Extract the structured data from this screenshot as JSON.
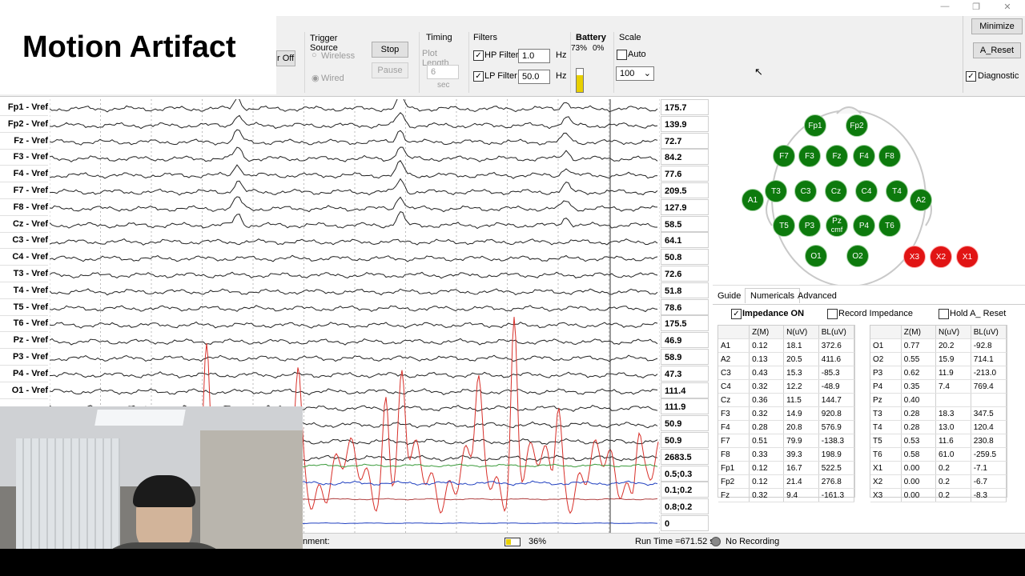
{
  "overlay_title": "Motion Artifact",
  "window": {
    "min": "—",
    "max": "❐",
    "close": "✕"
  },
  "toolbar": {
    "partial_button": "r Off",
    "trigger_source": {
      "title": "Trigger Source",
      "wireless": "Wireless",
      "wired": "Wired"
    },
    "stop_label": "Stop",
    "pause_label": "Pause",
    "timing": {
      "title": "Timing",
      "plot_length_label": "Plot Length",
      "plot_length_value": "6",
      "unit": "sec"
    },
    "filters": {
      "title": "Filters",
      "hp_label": "HP Filter",
      "hp_value": "1.0",
      "lp_label": "LP Filter",
      "lp_value": "50.0",
      "unit": "Hz"
    },
    "battery": {
      "title": "Battery",
      "pct1": "73%",
      "pct2": "0%",
      "level": 0.73,
      "color": "#e8d000"
    },
    "scale": {
      "title": "Scale",
      "auto_label": "Auto",
      "value": "100"
    },
    "minimize_label": "Minimize",
    "a_reset_label": "A_Reset",
    "diagnostic_label": "Diagnostic"
  },
  "channels": [
    {
      "label": "Fp1 - Vref",
      "value": "175.7"
    },
    {
      "label": "Fp2 - Vref",
      "value": "139.9"
    },
    {
      "label": "Fz - Vref",
      "value": "72.7"
    },
    {
      "label": "F3 - Vref",
      "value": "84.2"
    },
    {
      "label": "F4 - Vref",
      "value": "77.6"
    },
    {
      "label": "F7 - Vref",
      "value": "209.5"
    },
    {
      "label": "F8 - Vref",
      "value": "127.9"
    },
    {
      "label": "Cz - Vref",
      "value": "58.5"
    },
    {
      "label": "C3 - Vref",
      "value": "64.1"
    },
    {
      "label": "C4 - Vref",
      "value": "50.8"
    },
    {
      "label": "T3 - Vref",
      "value": "72.6"
    },
    {
      "label": "T4 - Vref",
      "value": "51.8"
    },
    {
      "label": "T5 - Vref",
      "value": "78.6"
    },
    {
      "label": "T6 - Vref",
      "value": "175.5"
    },
    {
      "label": "Pz - Vref",
      "value": "46.9"
    },
    {
      "label": "P3 - Vref",
      "value": "58.9"
    },
    {
      "label": "P4 - Vref",
      "value": "47.3"
    },
    {
      "label": "O1 - Vref",
      "value": "111.4"
    },
    {
      "label": "",
      "value": "111.9"
    },
    {
      "label": "",
      "value": "50.9"
    },
    {
      "label": "",
      "value": "50.9"
    },
    {
      "label": "",
      "value": "2683.5"
    },
    {
      "label": "",
      "value": "0.5;0.3"
    },
    {
      "label": "",
      "value": "0.1;0.2"
    },
    {
      "label": "",
      "value": "0.8;0.2"
    },
    {
      "label": "",
      "value": "0"
    }
  ],
  "electrodes": [
    {
      "name": "Fp1",
      "color": "green"
    },
    {
      "name": "Fp2",
      "color": "green"
    },
    {
      "name": "F7",
      "color": "green"
    },
    {
      "name": "F3",
      "color": "green"
    },
    {
      "name": "Fz",
      "color": "green"
    },
    {
      "name": "F4",
      "color": "green"
    },
    {
      "name": "F8",
      "color": "green"
    },
    {
      "name": "A1",
      "color": "green"
    },
    {
      "name": "T3",
      "color": "green"
    },
    {
      "name": "C3",
      "color": "green"
    },
    {
      "name": "Cz",
      "color": "green"
    },
    {
      "name": "C4",
      "color": "green"
    },
    {
      "name": "T4",
      "color": "green"
    },
    {
      "name": "A2",
      "color": "green"
    },
    {
      "name": "T5",
      "color": "green"
    },
    {
      "name": "P3",
      "color": "green"
    },
    {
      "name": "Pz",
      "sub": "cmf",
      "color": "green"
    },
    {
      "name": "P4",
      "color": "green"
    },
    {
      "name": "T6",
      "color": "green"
    },
    {
      "name": "O1",
      "color": "green"
    },
    {
      "name": "O2",
      "color": "green"
    },
    {
      "name": "X3",
      "color": "red"
    },
    {
      "name": "X2",
      "color": "red"
    },
    {
      "name": "X1",
      "color": "red"
    }
  ],
  "tabs": [
    "Guide",
    "Numericals",
    "Advanced"
  ],
  "options": {
    "impedance_on": "Impedance ON",
    "record_impedance": "Record Impedance",
    "hold_a_reset": "Hold A_ Reset"
  },
  "table_headers": [
    "",
    "Z(M)",
    "N(uV)",
    "BL(uV)"
  ],
  "table_left": [
    [
      "A1",
      "0.12",
      "18.1",
      "372.6"
    ],
    [
      "A2",
      "0.13",
      "20.5",
      "411.6"
    ],
    [
      "C3",
      "0.43",
      "15.3",
      "-85.3"
    ],
    [
      "C4",
      "0.32",
      "12.2",
      "-48.9"
    ],
    [
      "Cz",
      "0.36",
      "11.5",
      "144.7"
    ],
    [
      "F3",
      "0.32",
      "14.9",
      "920.8"
    ],
    [
      "F4",
      "0.28",
      "20.8",
      "576.9"
    ],
    [
      "F7",
      "0.51",
      "79.9",
      "-138.3"
    ],
    [
      "F8",
      "0.33",
      "39.3",
      "198.9"
    ],
    [
      "Fp1",
      "0.12",
      "16.7",
      "522.5"
    ],
    [
      "Fp2",
      "0.12",
      "21.4",
      "276.8"
    ],
    [
      "Fz",
      "0.32",
      "9.4",
      "-161.3"
    ]
  ],
  "table_right": [
    [
      "O1",
      "0.77",
      "20.2",
      "-92.8"
    ],
    [
      "O2",
      "0.55",
      "15.9",
      "714.1"
    ],
    [
      "P3",
      "0.62",
      "11.9",
      "-213.0"
    ],
    [
      "P4",
      "0.35",
      "7.4",
      "769.4"
    ],
    [
      "Pz",
      "0.40",
      "",
      ""
    ],
    [
      "T3",
      "0.28",
      "18.3",
      "347.5"
    ],
    [
      "T4",
      "0.28",
      "13.0",
      "120.4"
    ],
    [
      "T5",
      "0.53",
      "11.6",
      "230.8"
    ],
    [
      "T6",
      "0.58",
      "61.0",
      "-259.5"
    ],
    [
      "X1",
      "0.00",
      "0.2",
      "-7.1"
    ],
    [
      "X2",
      "0.00",
      "0.2",
      "-6.7"
    ],
    [
      "X3",
      "0.00",
      "0.2",
      "-8.3"
    ]
  ],
  "status": {
    "comment_label": "nment:",
    "battery_pct": "36%",
    "run_time": "Run Time =671.52 s",
    "recording": "No Recording"
  }
}
